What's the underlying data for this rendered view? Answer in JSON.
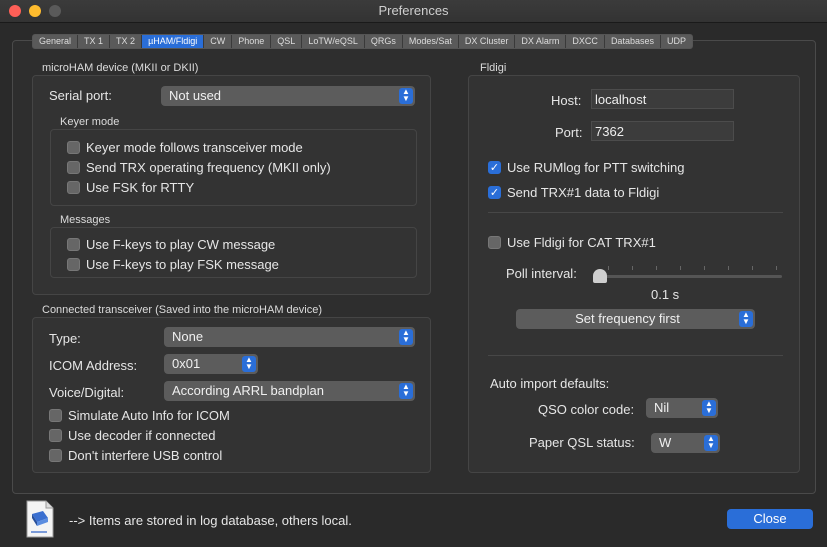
{
  "window": {
    "title": "Preferences"
  },
  "tabs": [
    "General",
    "TX 1",
    "TX 2",
    "µHAM/Fldigi",
    "CW",
    "Phone",
    "QSL",
    "LoTW/eQSL",
    "QRGs",
    "Modes/Sat",
    "DX Cluster",
    "DX Alarm",
    "DXCC",
    "Databases",
    "UDP"
  ],
  "active_tab": "µHAM/Fldigi",
  "microham": {
    "title": "microHAM device (MKII or DKII)",
    "serial_label": "Serial port:",
    "serial_value": "Not used",
    "keyer_title": "Keyer mode",
    "keyer_opts": [
      {
        "label": "Keyer mode follows transceiver mode",
        "checked": false
      },
      {
        "label": "Send TRX operating frequency (MKII only)",
        "checked": false
      },
      {
        "label": "Use FSK for RTTY",
        "checked": false
      }
    ],
    "messages_title": "Messages",
    "message_opts": [
      {
        "label": "Use F-keys to play CW message",
        "checked": false
      },
      {
        "label": "Use F-keys to play FSK message",
        "checked": false
      }
    ]
  },
  "transceiver": {
    "title": "Connected transceiver (Saved into the microHAM device)",
    "type_label": "Type:",
    "type_value": "None",
    "icom_label": "ICOM Address:",
    "icom_value": "0x01",
    "voice_label": "Voice/Digital:",
    "voice_value": "According ARRL bandplan",
    "opts": [
      {
        "label": "Simulate Auto Info for ICOM",
        "checked": false
      },
      {
        "label": "Use decoder if connected",
        "checked": false
      },
      {
        "label": "Don't interfere USB control",
        "checked": false
      }
    ]
  },
  "fldigi": {
    "title": "Fldigi",
    "host_label": "Host:",
    "host_value": "localhost",
    "port_label": "Port:",
    "port_value": "7362",
    "opts": [
      {
        "label": "Use RUMlog for PTT switching",
        "checked": true
      },
      {
        "label": "Send TRX#1 data to Fldigi",
        "checked": true
      }
    ],
    "cat_label": "Use Fldigi for CAT TRX#1",
    "cat_checked": false,
    "poll_label": "Poll interval:",
    "poll_value": "0.1 s",
    "set_freq_value": "Set frequency first",
    "auto_title": "Auto import defaults:",
    "qso_color_label": "QSO color code:",
    "qso_color_value": "Nil",
    "paper_label": "Paper QSL status:",
    "paper_value": "W"
  },
  "footer": {
    "note": "--> Items are stored in log database, others local.",
    "close_label": "Close"
  },
  "colors": {
    "accent": "#2a6ed8",
    "close_light": "#fe5f57",
    "min_light": "#febc2e",
    "zoom_light": "#5a5a5a"
  }
}
